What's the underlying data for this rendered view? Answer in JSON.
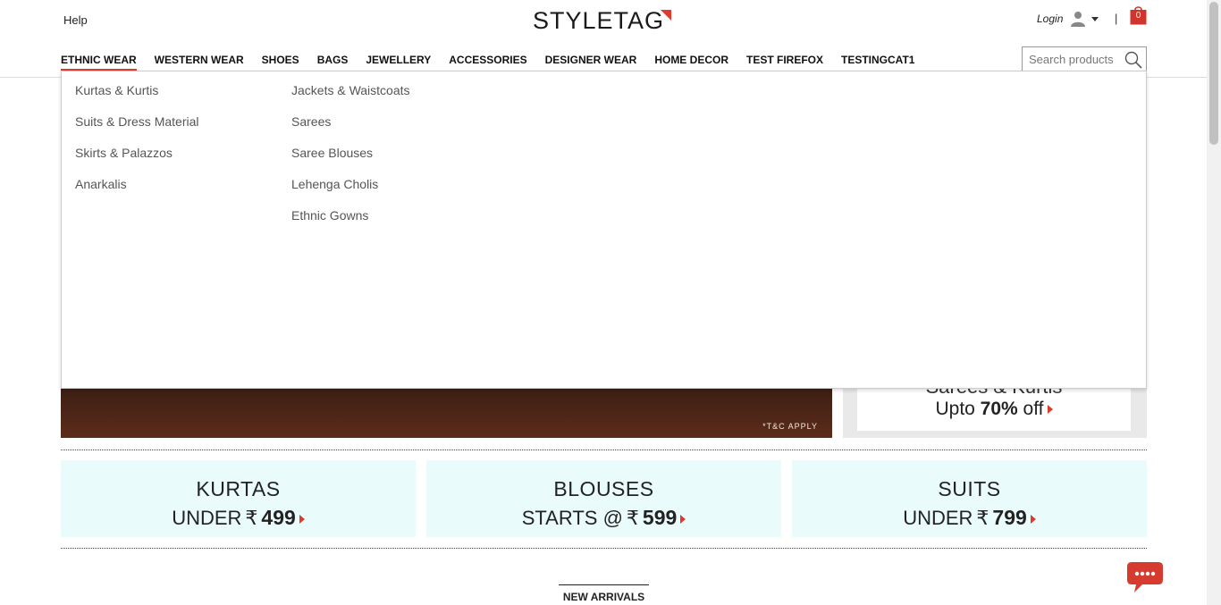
{
  "header": {
    "help_label": "Help",
    "logo_text": "STYLETAG",
    "login_label": "Login",
    "separator": "|",
    "cart_count": "0",
    "brand_color": "#e03a2e"
  },
  "nav": {
    "items": [
      "ETHNIC WEAR",
      "WESTERN WEAR",
      "SHOES",
      "BAGS",
      "JEWELLERY",
      "ACCESSORIES",
      "DESIGNER WEAR",
      "HOME DECOR",
      "TEST FIREFOX",
      "TESTINGCAT1"
    ],
    "active_index": 0
  },
  "search": {
    "placeholder": "Search products"
  },
  "mega_menu": {
    "column1": [
      "Kurtas & Kurtis",
      "Suits & Dress Material",
      "Skirts & Palazzos",
      "Anarkalis"
    ],
    "column2": [
      "Jackets & Waistcoats",
      "Sarees",
      "Saree Blouses",
      "Lehenga Cholis",
      "Ethnic Gowns"
    ]
  },
  "hero": {
    "tc_text": "*T&C APPLY"
  },
  "side_promo": {
    "line1": "Sarees & Kurtis",
    "line2_prefix": "Upto",
    "line2_bold": "70%",
    "line2_suffix": "off"
  },
  "tiles": [
    {
      "line1": "KURTAS",
      "line2": "UNDER",
      "currency": "₹",
      "amount": "499"
    },
    {
      "line1": "BLOUSES",
      "line2": "STARTS @",
      "currency": "₹",
      "amount": "599"
    },
    {
      "line1": "SUITS",
      "line2": "UNDER",
      "currency": "₹",
      "amount": "799"
    }
  ],
  "section_title": "NEW ARRIVALS"
}
